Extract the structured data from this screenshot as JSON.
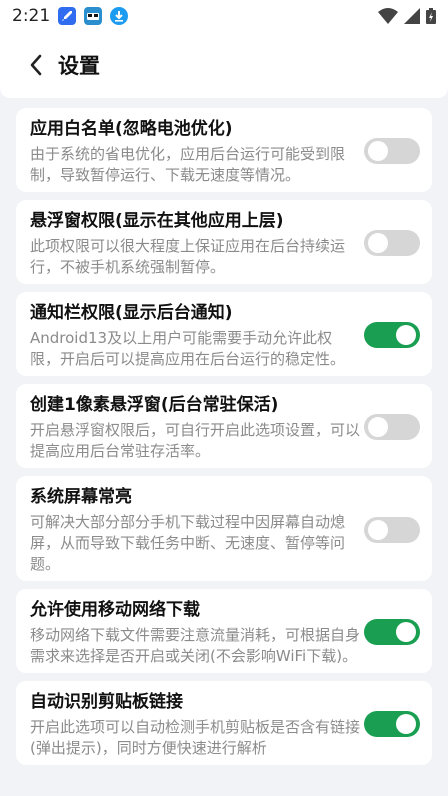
{
  "statusbar": {
    "time": "2:21"
  },
  "header": {
    "title": "设置"
  },
  "colors": {
    "toggle_on": "#1a9f52",
    "toggle_off": "#d6d6d6"
  },
  "settings": [
    {
      "title": "应用白名单(忽略电池优化)",
      "desc": "由于系统的省电优化，应用后台运行可能受到限制，导致暂停运行、下载无速度等情况。",
      "enabled": false
    },
    {
      "title": "悬浮窗权限(显示在其他应用上层)",
      "desc": "此项权限可以很大程度上保证应用在后台持续运行，不被手机系统强制暂停。",
      "enabled": false
    },
    {
      "title": "通知栏权限(显示后台通知)",
      "desc": "Android13及以上用户可能需要手动允许此权限，开启后可以提高应用在后台运行的稳定性。",
      "enabled": true
    },
    {
      "title": "创建1像素悬浮窗(后台常驻保活)",
      "desc": "开启悬浮窗权限后，可自行开启此选项设置，可以提高应用后台常驻存活率。",
      "enabled": false
    },
    {
      "title": "系统屏幕常亮",
      "desc": "可解决大部分部分手机下载过程中因屏幕自动熄屏，从而导致下载任务中断、无速度、暂停等问题。",
      "enabled": false
    },
    {
      "title": "允许使用移动网络下载",
      "desc": "移动网络下载文件需要注意流量消耗，可根据自身需求来选择是否开启或关闭(不会影响WiFi下载)。",
      "enabled": true
    },
    {
      "title": "自动识别剪贴板链接",
      "desc": "开启此选项可以自动检测手机剪贴板是否含有链接(弹出提示)，同时方便快速进行解析",
      "enabled": true
    }
  ]
}
